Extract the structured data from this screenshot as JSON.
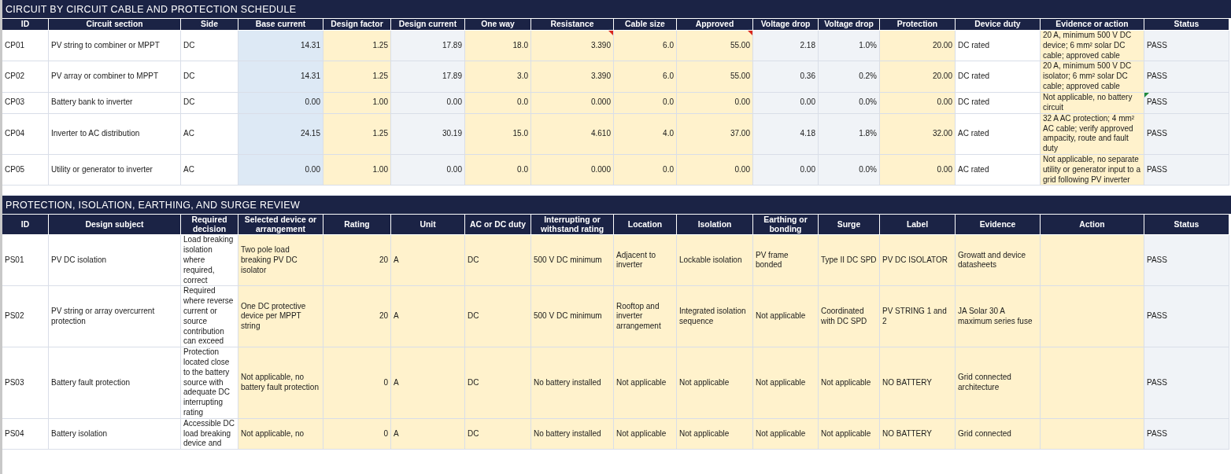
{
  "sections": [
    {
      "kind": "cable",
      "title": "CIRCUIT BY CIRCUIT CABLE AND PROTECTION SCHEDULE",
      "columns": [
        "ID",
        "Circuit section",
        "Side",
        "Base current",
        "Design factor",
        "Design current",
        "One way",
        "Resistance",
        "Cable size",
        "Approved",
        "Voltage drop",
        "Voltage drop",
        "Protection",
        "Device duty",
        "Evidence or action",
        "Status"
      ],
      "rows": [
        {
          "cells": [
            "CP01",
            "PV string to combiner or MPPT",
            "DC",
            "14.31",
            "1.25",
            "17.89",
            "18.0",
            {
              "text": "3.390",
              "note": true
            },
            "6.0",
            {
              "text": "55.00",
              "note": true
            },
            "2.18",
            "1.0%",
            "20.00",
            "DC rated",
            "20 A, minimum 500 V DC device; 6 mm² solar DC cable; approved cable",
            "PASS"
          ]
        },
        {
          "cells": [
            "CP02",
            "PV array or combiner to MPPT",
            "DC",
            "14.31",
            "1.25",
            "17.89",
            "3.0",
            "3.390",
            "6.0",
            "55.00",
            "0.36",
            "0.2%",
            "20.00",
            "DC rated",
            "20 A, minimum 500 V DC isolator; 6 mm² solar DC cable; approved cable",
            "PASS"
          ]
        },
        {
          "cells": [
            "CP03",
            "Battery bank to inverter",
            "DC",
            "0.00",
            "1.00",
            "0.00",
            "0.0",
            "0.000",
            "0.0",
            "0.00",
            "0.00",
            "0.0%",
            "0.00",
            "DC rated",
            "Not applicable, no battery circuit",
            {
              "text": "PASS",
              "warning": true
            }
          ]
        },
        {
          "cells": [
            "CP04",
            "Inverter to AC distribution",
            "AC",
            "24.15",
            "1.25",
            "30.19",
            "15.0",
            "4.610",
            "4.0",
            "37.00",
            "4.18",
            "1.8%",
            "32.00",
            "AC rated",
            "32 A AC protection; 4 mm² AC cable; verify approved ampacity, route and fault duty",
            "PASS"
          ]
        },
        {
          "cells": [
            "CP05",
            "Utility or generator to inverter",
            "AC",
            "0.00",
            "1.00",
            "0.00",
            "0.0",
            "0.000",
            "0.0",
            "0.00",
            "0.00",
            "0.0%",
            "0.00",
            "AC rated",
            "Not applicable, no separate utility or generator input to a grid following PV inverter",
            "PASS"
          ]
        }
      ]
    },
    {
      "kind": "protection",
      "title": "PROTECTION, ISOLATION, EARTHING, AND SURGE REVIEW",
      "columns": [
        "ID",
        "Design subject",
        "Required decision",
        "Selected device or arrangement",
        "Rating",
        "Unit",
        "AC or DC duty",
        "Interrupting or withstand rating",
        "Location",
        "Isolation",
        "Earthing or bonding",
        "Surge",
        "Label",
        "Evidence",
        "Action",
        "Status"
      ],
      "rows": [
        {
          "cells": [
            "PS01",
            "PV DC isolation",
            "Load breaking isolation where required, correct",
            "Two pole load breaking PV DC isolator",
            "20",
            "A",
            "DC",
            "500 V DC minimum",
            "Adjacent to inverter",
            "Lockable isolation",
            "PV frame bonded",
            "Type II DC SPD",
            "PV DC ISOLATOR",
            "Growatt and device datasheets",
            "",
            "PASS"
          ]
        },
        {
          "cells": [
            "PS02",
            "PV string or array overcurrent protection",
            "Required where reverse current or source contribution can exceed",
            "One DC protective device per MPPT string",
            "20",
            "A",
            "DC",
            "500 V DC minimum",
            "Rooftop and inverter arrangement",
            "Integrated isolation sequence",
            "Not applicable",
            "Coordinated with DC SPD",
            "PV STRING 1 and 2",
            "JA Solar 30 A maximum series fuse",
            "",
            "PASS"
          ]
        },
        {
          "cells": [
            "PS03",
            "Battery fault protection",
            "Protection located close to the battery source with adequate DC interrupting rating",
            "Not applicable, no battery fault protection",
            "0",
            "A",
            "DC",
            "No battery installed",
            "Not applicable",
            "Not applicable",
            "Not applicable",
            "Not applicable",
            "NO BATTERY",
            "Grid connected architecture",
            "",
            "PASS"
          ]
        },
        {
          "cells": [
            "PS04",
            "Battery isolation",
            "Accessible DC load breaking device and",
            "Not applicable, no",
            "0",
            "A",
            "DC",
            "No battery installed",
            "Not applicable",
            "Not applicable",
            "Not applicable",
            "Not applicable",
            "NO BATTERY",
            "Grid connected",
            "",
            "PASS"
          ]
        }
      ]
    }
  ]
}
